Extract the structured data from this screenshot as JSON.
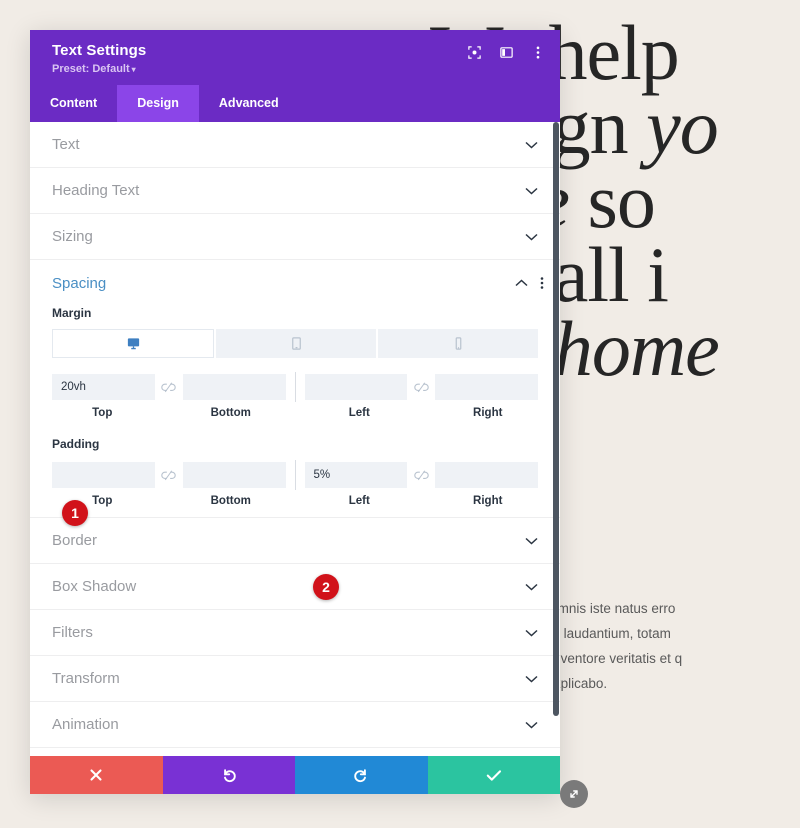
{
  "background": {
    "hero_lines": [
      {
        "plain": "We help",
        "italic": ""
      },
      {
        "plain": "design ",
        "italic": "yo"
      },
      {
        "plain": "",
        "italic": "ouse",
        "tail": " so "
      },
      {
        "plain": "an call i",
        "italic": ""
      },
      {
        "plain": "",
        "italic": "our home"
      }
    ],
    "hero_text": "We help design your house so you can call it your home",
    "paragraph_lines": [
      "ut perspiciatis unde omnis iste natus erro",
      "usantium doloremque laudantium, totam",
      "ue ipsa quae ab illo inventore veritatis et q",
      "tae vitae dicta sunt explicabo."
    ],
    "page_bg_color": "#f1ece6"
  },
  "panel": {
    "title": "Text Settings",
    "preset_label": "Preset: Default",
    "preset_caret": "▾",
    "header_color": "#6b2bc4",
    "header_icons": [
      {
        "name": "focus-icon",
        "label": "Focus"
      },
      {
        "name": "layout-columns-icon",
        "label": "Layout"
      },
      {
        "name": "more-options-icon",
        "label": "More Options"
      }
    ],
    "tabs": [
      {
        "label": "Content",
        "active": false
      },
      {
        "label": "Design",
        "active": true
      },
      {
        "label": "Advanced",
        "active": false
      }
    ],
    "active_tab_color": "#8b45e8"
  },
  "sections": [
    {
      "label": "Text",
      "expanded": false
    },
    {
      "label": "Heading Text",
      "expanded": false
    },
    {
      "label": "Sizing",
      "expanded": false
    }
  ],
  "sections_below": [
    {
      "label": "Border",
      "expanded": false
    },
    {
      "label": "Box Shadow",
      "expanded": false
    },
    {
      "label": "Filters",
      "expanded": false
    },
    {
      "label": "Transform",
      "expanded": false
    },
    {
      "label": "Animation",
      "expanded": false
    }
  ],
  "spacing": {
    "title": "Spacing",
    "title_color": "#4a8fc4",
    "expanded": true,
    "devices": [
      {
        "name": "desktop",
        "active": true
      },
      {
        "name": "tablet",
        "active": false
      },
      {
        "name": "phone",
        "active": false
      }
    ],
    "margin": {
      "label": "Margin",
      "top": "20vh",
      "bottom": "",
      "left": "",
      "right": "",
      "labels": {
        "top": "Top",
        "bottom": "Bottom",
        "left": "Left",
        "right": "Right"
      }
    },
    "padding": {
      "label": "Padding",
      "top": "",
      "bottom": "",
      "left": "5%",
      "right": "",
      "labels": {
        "top": "Top",
        "bottom": "Bottom",
        "left": "Left",
        "right": "Right"
      }
    }
  },
  "badges": [
    {
      "number": "1",
      "color": "#d1121a"
    },
    {
      "number": "2",
      "color": "#d1121a"
    }
  ],
  "footer": {
    "buttons": [
      {
        "name": "cancel",
        "glyph": "✖",
        "color": "#eb5a54"
      },
      {
        "name": "undo",
        "glyph": "↺",
        "color": "#7931d4"
      },
      {
        "name": "redo",
        "glyph": "↻",
        "color": "#2189d6"
      },
      {
        "name": "save",
        "glyph": "✔",
        "color": "#2bc4a0"
      }
    ]
  }
}
